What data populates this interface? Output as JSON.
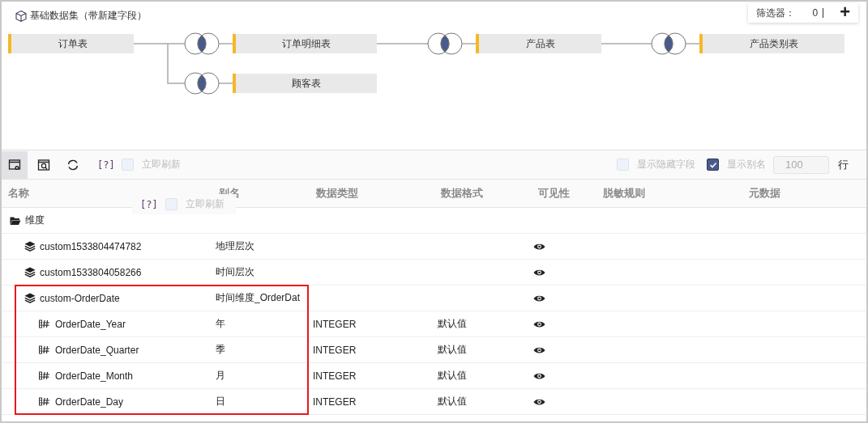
{
  "title": "基础数据集（带新建字段）",
  "filter": {
    "label": "筛选器：",
    "count": "0",
    "add": "+"
  },
  "diagram": {
    "table": {
      "name": "订单表",
      "joins": [
        {
          "name": "订单明细表",
          "joins": [
            {
              "name": "产品表",
              "joins": [
                {
                  "name": "产品类别表"
                }
              ]
            }
          ]
        },
        {
          "name": "顾客表"
        }
      ]
    }
  },
  "toolbar": {
    "view_buttons": [
      {
        "selected": true
      },
      {
        "selected": false
      },
      {
        "selected": false
      }
    ],
    "help": "[?]",
    "auto_refresh": {
      "label": "立即刷新",
      "checked": false,
      "disabled": true
    },
    "show_hidden": {
      "label": "显示隐藏字段",
      "checked": false,
      "disabled": true
    },
    "show_alias": {
      "label": "显示别名",
      "checked": true,
      "disabled": true
    },
    "rows_input": {
      "value": "100"
    },
    "rows_unit": "行"
  },
  "columns": [
    "名称",
    "别名",
    "数据类型",
    "数据格式",
    "可见性",
    "脱敏规则",
    "元数据"
  ],
  "drag_ghost": {
    "help": "[?]",
    "label": "立即刷新",
    "checked": false
  },
  "rows": [
    {
      "kind": "folder",
      "name": "维度",
      "visible": false,
      "highlighted": false,
      "children": [
        {
          "kind": "hierarchy",
          "name": "custom1533804474782",
          "alias": "地理层次",
          "visible": true,
          "highlighted": false
        },
        {
          "kind": "hierarchy",
          "name": "custom1533804058266",
          "alias": "时间层次",
          "visible": true,
          "highlighted": false
        },
        {
          "kind": "hierarchy",
          "name": "custom-OrderDate",
          "alias": "时间维度_OrderDat",
          "visible": true,
          "highlighted": true,
          "children": [
            {
              "kind": "number",
              "name": "OrderDate_Year",
              "alias": "年",
              "type": "INTEGER",
              "format": "默认值",
              "visible": true,
              "highlighted": false
            },
            {
              "kind": "number",
              "name": "OrderDate_Quarter",
              "alias": "季",
              "type": "INTEGER",
              "format": "默认值",
              "visible": true,
              "highlighted": false
            },
            {
              "kind": "number",
              "name": "OrderDate_Month",
              "alias": "月",
              "type": "INTEGER",
              "format": "默认值",
              "visible": true,
              "highlighted": false
            },
            {
              "kind": "number",
              "name": "OrderDate_Day",
              "alias": "日",
              "type": "INTEGER",
              "format": "默认值",
              "visible": true,
              "highlighted": false
            }
          ]
        }
      ]
    }
  ]
}
